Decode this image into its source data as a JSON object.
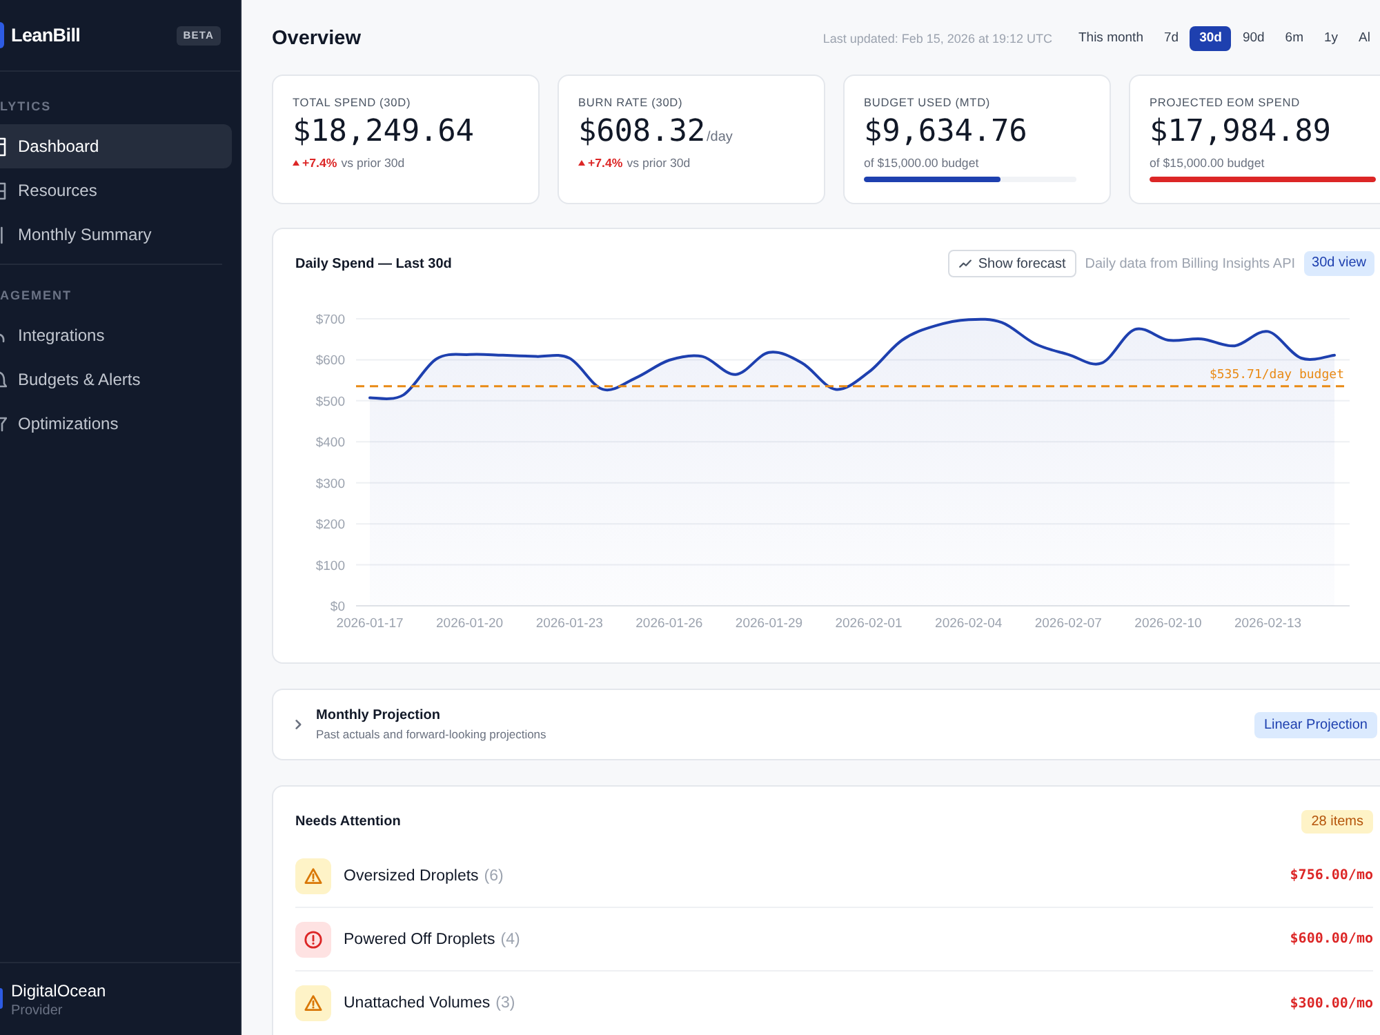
{
  "sidebar": {
    "brand": {
      "name": "LeanBill",
      "badge": "BETA"
    },
    "sections": [
      {
        "heading": "LYTICS",
        "items": [
          {
            "label": "Dashboard",
            "selected": true
          },
          {
            "label": "Resources",
            "selected": false
          },
          {
            "label": "Monthly Summary",
            "selected": false
          }
        ]
      },
      {
        "heading": "AGEMENT",
        "items": [
          {
            "label": "Integrations",
            "selected": false
          },
          {
            "label": "Budgets & Alerts",
            "selected": false
          },
          {
            "label": "Optimizations",
            "selected": false
          }
        ]
      }
    ],
    "footer": {
      "name": "DigitalOcean",
      "caption": "Provider"
    }
  },
  "header": {
    "title": "Overview",
    "last_updated": "Last updated: Feb 15, 2026 at 19:12 UTC",
    "ranges": [
      {
        "label": "This month",
        "selected": false
      },
      {
        "label": "7d",
        "selected": false
      },
      {
        "label": "30d",
        "selected": true
      },
      {
        "label": "90d",
        "selected": false
      },
      {
        "label": "6m",
        "selected": false
      },
      {
        "label": "1y",
        "selected": false
      },
      {
        "label": "Al",
        "selected": false
      }
    ]
  },
  "stats": [
    {
      "kind": "delta",
      "label": "TOTAL SPEND (30D)",
      "value": "$18,249.64",
      "delta": "+7.4%",
      "caption": "vs prior 30d"
    },
    {
      "kind": "delta",
      "label": "BURN RATE (30D)",
      "value": "$608.32",
      "unit": "/day",
      "delta": "+7.4%",
      "caption": "vs prior 30d"
    },
    {
      "kind": "budget",
      "label": "BUDGET USED (MTD)",
      "value": "$9,634.76",
      "caption": "of $15,000.00 budget",
      "level": 0.64,
      "color": "#1e40af"
    },
    {
      "kind": "budget",
      "label": "PROJECTED EOM SPEND",
      "value": "$17,984.89",
      "caption": "of $15,000.00 budget",
      "level": 1,
      "color": "#dc2626"
    }
  ],
  "chart": {
    "forecast_button": "Show forecast",
    "source": "Daily data from Billing Insights API",
    "badge": "30d view",
    "chart_data": {
      "type": "line",
      "title": "Daily Spend — Last 30d",
      "categories": [
        "2026-01-17",
        null,
        null,
        "2026-01-20",
        null,
        null,
        "2026-01-23",
        null,
        null,
        "2026-01-26",
        null,
        null,
        "2026-01-29",
        null,
        null,
        "2026-02-01",
        null,
        null,
        "2026-02-04",
        null,
        null,
        "2026-02-07",
        null,
        null,
        "2026-02-10",
        null,
        null,
        "2026-02-13",
        null,
        null
      ],
      "series": [
        {
          "color": "#1e40af",
          "values": [
            507,
            514,
            602,
            613,
            611,
            608,
            604,
            528,
            556,
            599,
            608,
            564,
            618,
            592,
            528,
            570,
            648,
            683,
            698,
            691,
            639,
            613,
            592,
            674,
            648,
            651,
            634,
            669,
            604,
            611
          ]
        }
      ],
      "ylim": [
        0,
        700
      ],
      "yticks": [
        {
          "value": 0,
          "label": "$0"
        },
        {
          "value": 100,
          "label": "$100"
        },
        {
          "value": 200,
          "label": "$200"
        },
        {
          "value": 300,
          "label": "$300"
        },
        {
          "value": 400,
          "label": "$400"
        },
        {
          "value": 500,
          "label": "$500"
        },
        {
          "value": 600,
          "label": "$600"
        },
        {
          "value": 700,
          "label": "$700"
        }
      ],
      "grid": true,
      "ref_lines": [
        {
          "axis": "y",
          "value": 535.71,
          "label": "$535.71/day budget",
          "color": "#e98a15"
        }
      ]
    }
  },
  "projection": {
    "title": "Monthly Projection",
    "subtitle": "Past actuals and forward-looking projections",
    "badge": "Linear Projection",
    "expanded": false
  },
  "attention": {
    "title": "Needs Attention",
    "badge": "28 items",
    "rows": [
      {
        "kind": "warning",
        "label": "Oversized Droplets",
        "count": "(6)",
        "amount": "$756.00/mo"
      },
      {
        "kind": "error",
        "label": "Powered Off Droplets",
        "count": "(4)",
        "amount": "$600.00/mo"
      },
      {
        "kind": "warning",
        "label": "Unattached Volumes",
        "count": "(3)",
        "amount": "$300.00/mo"
      }
    ]
  }
}
